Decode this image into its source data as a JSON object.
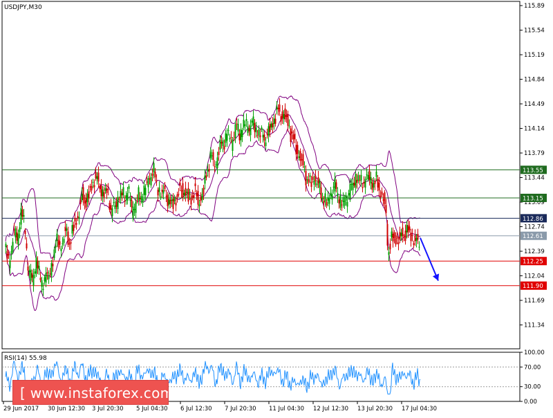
{
  "chart_data": {
    "type": "candlestick",
    "symbol_label": "USDJPY,M30",
    "price_axis": {
      "ylim": [
        111.0,
        115.95
      ],
      "tick_labels": [
        "115.89",
        "115.54",
        "115.19",
        "114.84",
        "114.49",
        "114.14",
        "113.79",
        "113.44",
        "113.09",
        "112.74",
        "112.39",
        "112.04",
        "111.69",
        "111.34"
      ],
      "tick_values": [
        115.89,
        115.54,
        115.19,
        114.84,
        114.49,
        114.14,
        113.79,
        113.44,
        113.09,
        112.74,
        112.39,
        112.04,
        111.69,
        111.34
      ]
    },
    "levels": [
      {
        "label": "113.55",
        "value": 113.55,
        "color": "#1f6b1f"
      },
      {
        "label": "113.15",
        "value": 113.15,
        "color": "#1f6b1f"
      },
      {
        "label": "112.86",
        "value": 112.86,
        "color": "#1a2a5a"
      },
      {
        "label": "112.61",
        "value": 112.61,
        "color": "#8a9aaa"
      },
      {
        "label": "112.25",
        "value": 112.25,
        "color": "#e00000"
      },
      {
        "label": "111.90",
        "value": 111.9,
        "color": "#e00000"
      }
    ],
    "x_axis": {
      "tick_labels": [
        "29 Jun 2017",
        "30 Jun 12:30",
        "3 Jul 20:30",
        "5 Jul 04:30",
        "6 Jul 12:30",
        "7 Jul 20:30",
        "11 Jul 04:30",
        "12 Jul 12:30",
        "13 Jul 20:30",
        "17 Jul 04:30"
      ]
    },
    "price_path": [
      [
        0,
        112.45
      ],
      [
        6,
        112.2
      ],
      [
        12,
        112.65
      ],
      [
        18,
        112.55
      ],
      [
        24,
        113.0
      ],
      [
        28,
        112.7
      ],
      [
        34,
        112.1
      ],
      [
        40,
        111.95
      ],
      [
        46,
        112.3
      ],
      [
        52,
        111.85
      ],
      [
        58,
        112.05
      ],
      [
        64,
        112.0
      ],
      [
        70,
        112.35
      ],
      [
        76,
        112.55
      ],
      [
        82,
        112.45
      ],
      [
        88,
        112.7
      ],
      [
        94,
        112.5
      ],
      [
        100,
        112.8
      ],
      [
        106,
        112.9
      ],
      [
        112,
        113.2
      ],
      [
        118,
        113.1
      ],
      [
        124,
        113.3
      ],
      [
        130,
        113.45
      ],
      [
        136,
        113.35
      ],
      [
        142,
        113.2
      ],
      [
        148,
        113.25
      ],
      [
        154,
        112.95
      ],
      [
        160,
        113.05
      ],
      [
        166,
        113.2
      ],
      [
        172,
        113.15
      ],
      [
        178,
        113.25
      ],
      [
        184,
        112.95
      ],
      [
        190,
        113.1
      ],
      [
        196,
        113.15
      ],
      [
        202,
        113.25
      ],
      [
        208,
        113.4
      ],
      [
        214,
        113.55
      ],
      [
        220,
        113.3
      ],
      [
        226,
        113.2
      ],
      [
        232,
        113.25
      ],
      [
        238,
        113.05
      ],
      [
        244,
        113.1
      ],
      [
        250,
        113.2
      ],
      [
        256,
        113.3
      ],
      [
        262,
        113.2
      ],
      [
        268,
        113.15
      ],
      [
        274,
        113.25
      ],
      [
        280,
        113.1
      ],
      [
        286,
        113.2
      ],
      [
        292,
        113.55
      ],
      [
        298,
        113.75
      ],
      [
        304,
        113.6
      ],
      [
        310,
        113.85
      ],
      [
        316,
        113.95
      ],
      [
        322,
        114.05
      ],
      [
        328,
        113.95
      ],
      [
        334,
        114.15
      ],
      [
        340,
        114.05
      ],
      [
        346,
        114.2
      ],
      [
        352,
        114.15
      ],
      [
        358,
        114.2
      ],
      [
        364,
        114.1
      ],
      [
        370,
        114.05
      ],
      [
        376,
        114.0
      ],
      [
        382,
        114.1
      ],
      [
        388,
        114.25
      ],
      [
        394,
        114.4
      ],
      [
        400,
        114.35
      ],
      [
        406,
        114.3
      ],
      [
        412,
        114.15
      ],
      [
        418,
        113.95
      ],
      [
        424,
        113.8
      ],
      [
        430,
        113.65
      ],
      [
        436,
        113.45
      ],
      [
        442,
        113.35
      ],
      [
        448,
        113.45
      ],
      [
        454,
        113.3
      ],
      [
        460,
        113.15
      ],
      [
        466,
        113.05
      ],
      [
        472,
        113.25
      ],
      [
        478,
        113.3
      ],
      [
        484,
        113.1
      ],
      [
        490,
        113.05
      ],
      [
        496,
        113.2
      ],
      [
        502,
        113.3
      ],
      [
        508,
        113.45
      ],
      [
        514,
        113.35
      ],
      [
        520,
        113.4
      ],
      [
        526,
        113.45
      ],
      [
        532,
        113.35
      ],
      [
        538,
        113.4
      ],
      [
        544,
        113.2
      ],
      [
        550,
        113.05
      ],
      [
        554,
        112.4
      ],
      [
        558,
        112.55
      ],
      [
        564,
        112.6
      ],
      [
        570,
        112.55
      ],
      [
        576,
        112.65
      ],
      [
        582,
        112.7
      ],
      [
        588,
        112.6
      ],
      [
        594,
        112.55
      ],
      [
        600,
        112.45
      ]
    ],
    "rsi": {
      "label": "RSI(14) 55.98",
      "ylim": [
        0,
        100
      ],
      "tick_labels": [
        "100.00",
        "70.00",
        "30.00",
        "0.00"
      ],
      "tick_values": [
        100,
        70,
        30,
        0
      ],
      "levels": [
        70,
        30
      ],
      "line_color": "#1e90ff"
    },
    "bollinger_color": "#800080",
    "forecast_arrow": {
      "color": "#1414ff",
      "from": [
        600,
        112.58
      ],
      "to": [
        626,
        111.97
      ]
    }
  },
  "watermark": {
    "text": "[ www.instaforex.com ]"
  }
}
